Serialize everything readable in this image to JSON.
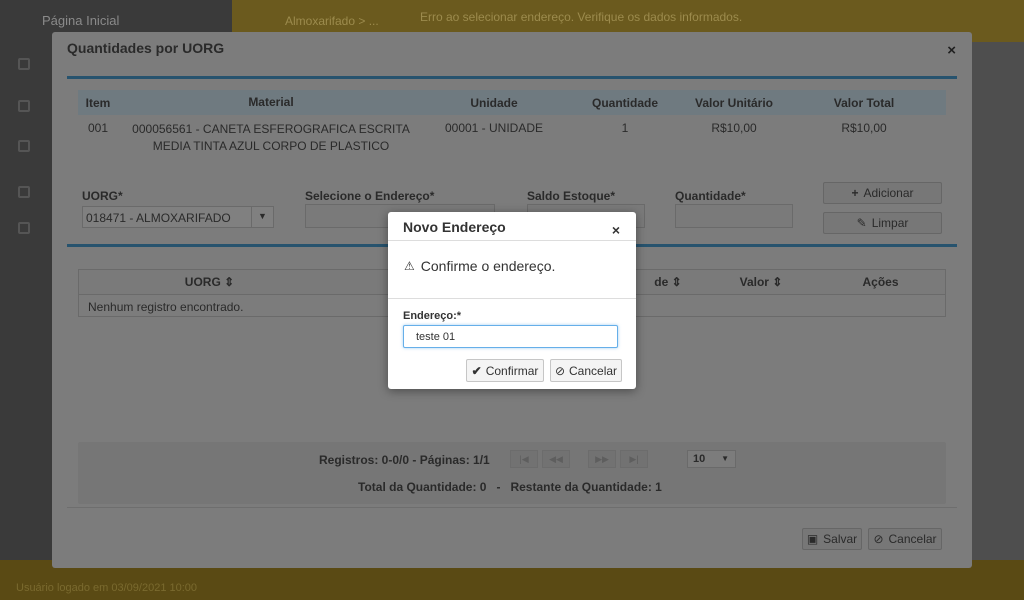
{
  "background": {
    "brand": "Página Inicial",
    "crumb": "Almoxarifado > ...",
    "alert": "Erro ao selecionar endereço. Verifique os dados informados.",
    "footer": "Usuário logado em 03/09/2021 10:00"
  },
  "modal": {
    "title": "Quantidades por UORG",
    "close": "×",
    "table": {
      "headers": [
        "Item",
        "Material",
        "Unidade",
        "Quantidade",
        "Valor Unitário",
        "Valor Total"
      ],
      "row": {
        "item": "001",
        "material": "000056561 - CANETA ESFEROGRAFICA ESCRITA MEDIA TINTA AZUL CORPO DE PLASTICO",
        "unidade": "00001 - UNIDADE",
        "quantidade": "1",
        "valor_unitario": "R$10,00",
        "valor_total": "R$10,00"
      }
    },
    "form": {
      "uorg_label": "UORG*",
      "uorg_value": "018471 - ALMOXARIFADO",
      "endereco_label": "Selecione o Endereço*",
      "saldo_label": "Saldo Estoque*",
      "quantidade_label": "Quantidade*",
      "adicionar": "Adicionar",
      "limpar": "Limpar"
    },
    "list": {
      "headers": [
        "UORG",
        "",
        "",
        "de",
        "Valor",
        "Ações"
      ],
      "empty": "Nenhum registro encontrado."
    },
    "pager": {
      "summary": "Registros: 0-0/0 - Páginas: 1/1",
      "page_size": "10",
      "totals": "Total da Quantidade: 0   -   Restante da Quantidade: 1"
    },
    "footer": {
      "salvar": "Salvar",
      "cancelar": "Cancelar"
    }
  },
  "dialog": {
    "title": "Novo Endereço",
    "close": "×",
    "message": "Confirme o endereço.",
    "field_label": "Endereço:*",
    "field_value": "teste 01",
    "confirm": "Confirmar",
    "cancel": "Cancelar"
  }
}
